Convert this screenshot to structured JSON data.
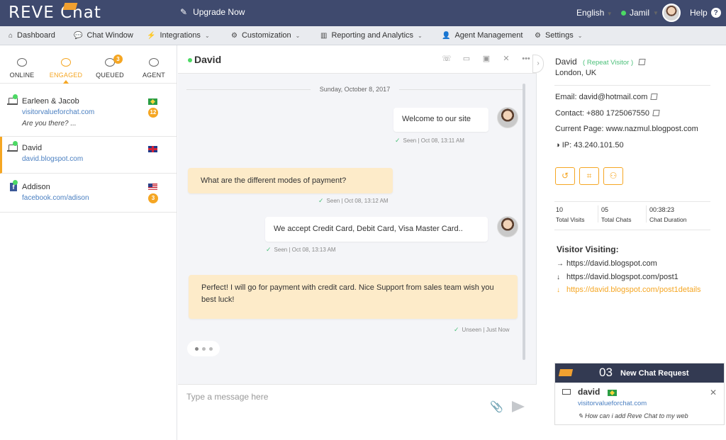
{
  "topbar": {
    "logo": "REVE Chat",
    "upgrade": "Upgrade Now",
    "language": "English",
    "user": "Jamil",
    "help": "Help"
  },
  "nav": [
    {
      "label": "Dashboard",
      "icon": "home-icon"
    },
    {
      "label": "Chat Window",
      "icon": "chat-icon"
    },
    {
      "label": "Integrations",
      "icon": "plug-icon"
    },
    {
      "label": "Customization",
      "icon": "gear-icon"
    },
    {
      "label": "Reporting and Analytics",
      "icon": "bar-chart-icon"
    },
    {
      "label": "Agent Management",
      "icon": "person-icon"
    },
    {
      "label": "Settings",
      "icon": "gears-icon"
    }
  ],
  "tabs": [
    {
      "label": "ONLINE"
    },
    {
      "label": "ENGAGED"
    },
    {
      "label": "QUEUED",
      "badge": "3"
    },
    {
      "label": "AGENT"
    }
  ],
  "visitors": [
    {
      "name": "Earleen & Jacob",
      "url": "visitorvalueforchat.com",
      "message": "Are you there? ...",
      "badge": "12",
      "flag": "brazil"
    },
    {
      "name": "David",
      "url": "david.blogspot.com",
      "flag": "uk"
    },
    {
      "name": "Addison",
      "url": "facebook.com/adison",
      "badge": "3",
      "flag": "usa"
    }
  ],
  "chat": {
    "name": "David",
    "date": "Sunday, October 8, 2017",
    "messages": [
      {
        "from": "agent",
        "text": "Welcome to our site",
        "meta": "Seen | Oct 08, 13:11 AM"
      },
      {
        "from": "visitor",
        "text": "What are the different modes of payment?",
        "meta": "Seen | Oct 08, 13:12 AM"
      },
      {
        "from": "agent",
        "text": "We accept Credit Card, Debit Card, Visa Master Card..",
        "meta": "Seen | Oct 08, 13:13 AM"
      },
      {
        "from": "visitor",
        "text": "Perfect! I will go for payment with credit card. Nice Support from sales team wish you best luck!",
        "meta": "Unseen | Just Now"
      }
    ],
    "placeholder": "Type a message here"
  },
  "profile": {
    "name": "David",
    "tag": "( Repeat Visitor )",
    "location": "London, UK",
    "email": "Email: david@hotmail.com",
    "contact": "Contact: +880 1725067550",
    "current_page": "Current Page: www.nazmul.blogpost.com",
    "ip": "IP: 43.240.101.50",
    "stats": [
      {
        "value": "10",
        "label": "Total Visits"
      },
      {
        "value": "05",
        "label": "Total Chats"
      },
      {
        "value": "00:38:23",
        "label": "Chat Duration"
      }
    ],
    "visiting_title": "Visitor Visiting:",
    "visiting": [
      {
        "url": "https://david.blogspot.com",
        "arrow": "→"
      },
      {
        "url": "https://david.blogspot.com/post1",
        "arrow": "↓"
      },
      {
        "url": "https://david.blogspot.com/post1details",
        "arrow": "↓"
      }
    ]
  },
  "new_request": {
    "count": "03",
    "title": "New Chat Request",
    "name": "david",
    "url": "visitorvalueforchat.com",
    "message": "How can i add Reve Chat to my web"
  },
  "colors": {
    "topbar": "#3f4a6e",
    "accent": "#f5a623",
    "online": "#4cd964",
    "link": "#4a7fc1",
    "visitor_bubble": "#fdebc9"
  }
}
